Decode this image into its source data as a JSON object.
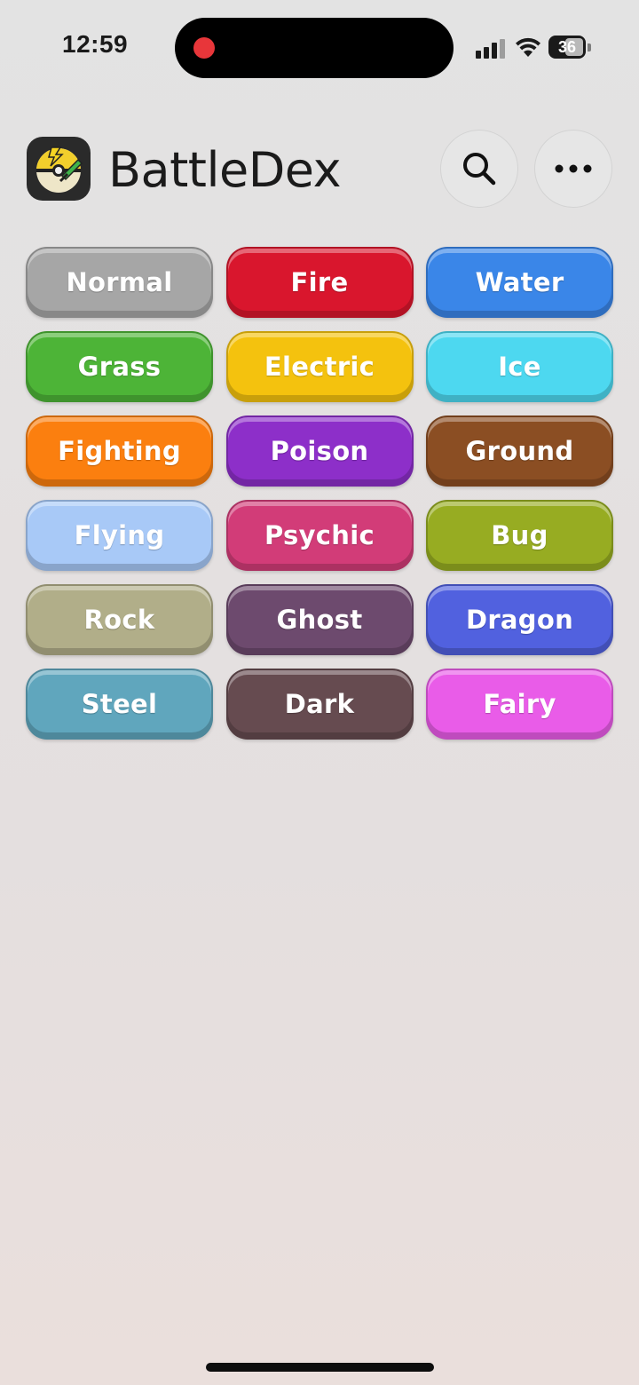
{
  "status_bar": {
    "time": "12:59",
    "battery": "36",
    "recording_color": "#e8363a"
  },
  "header": {
    "logo_icon": "pokeball-bolt-logo-icon",
    "title": "BattleDex",
    "search_icon": "search-icon",
    "more_icon": "more-horizontal-icon"
  },
  "types": [
    {
      "label": "Normal",
      "color": "#a6a6a6"
    },
    {
      "label": "Fire",
      "color": "#d9162d"
    },
    {
      "label": "Water",
      "color": "#3a86e8"
    },
    {
      "label": "Grass",
      "color": "#4db437"
    },
    {
      "label": "Electric",
      "color": "#f4c20e"
    },
    {
      "label": "Ice",
      "color": "#4dd8f0"
    },
    {
      "label": "Fighting",
      "color": "#fb7f0f"
    },
    {
      "label": "Poison",
      "color": "#8d2fc9"
    },
    {
      "label": "Ground",
      "color": "#8b4e23"
    },
    {
      "label": "Flying",
      "color": "#a8c9f7"
    },
    {
      "label": "Psychic",
      "color": "#d23c78"
    },
    {
      "label": "Bug",
      "color": "#97ac22"
    },
    {
      "label": "Rock",
      "color": "#b1ae89"
    },
    {
      "label": "Ghost",
      "color": "#6d4a6e"
    },
    {
      "label": "Dragon",
      "color": "#5161df"
    },
    {
      "label": "Steel",
      "color": "#60a6bd"
    },
    {
      "label": "Dark",
      "color": "#664b50"
    },
    {
      "label": "Fairy",
      "color": "#e95ce8"
    }
  ]
}
